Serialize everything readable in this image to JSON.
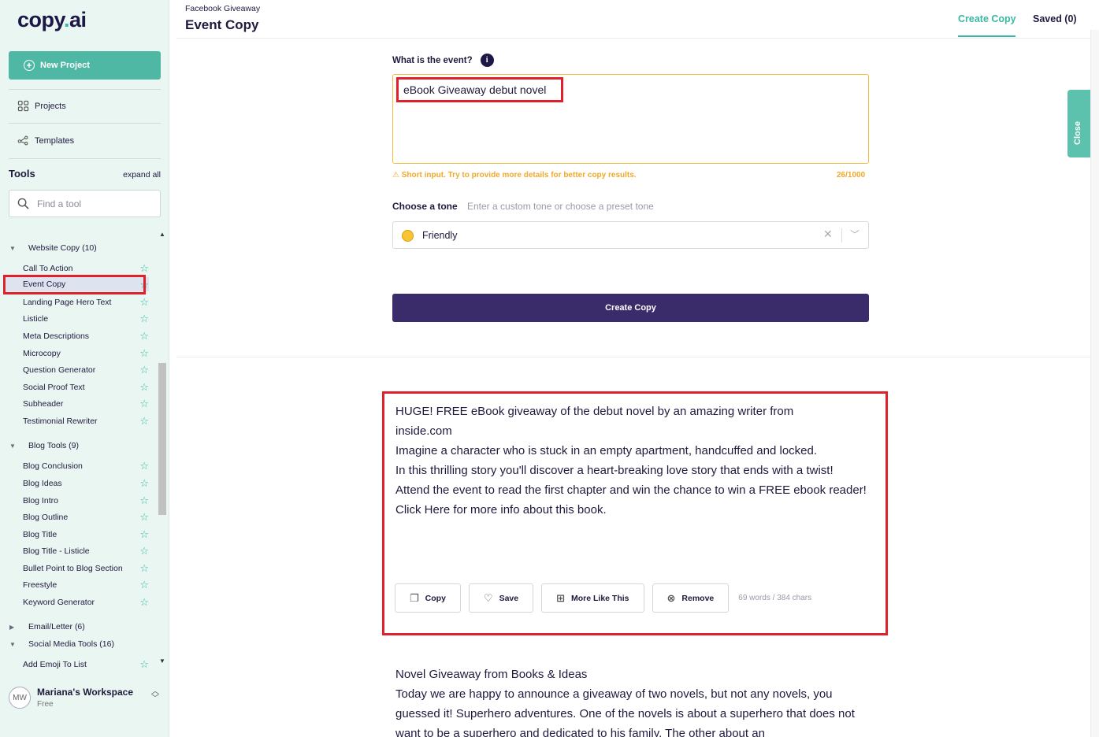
{
  "sidebar": {
    "logo_main": "copy",
    "logo_dot": ".",
    "logo_end": "ai",
    "new_project": "New Project",
    "projects": "Projects",
    "templates": "Templates",
    "tools_title": "Tools",
    "expand_all": "expand all",
    "search_placeholder": "Find a tool",
    "categories": {
      "website": "Website Copy (10)",
      "blog": "Blog Tools (9)",
      "email": "Email/Letter (6)",
      "social": "Social Media Tools (16)"
    },
    "website_tools": [
      "Call To Action",
      "Event Copy",
      "Landing Page Hero Text",
      "Listicle",
      "Meta Descriptions",
      "Microcopy",
      "Question Generator",
      "Social Proof Text",
      "Subheader",
      "Testimonial Rewriter"
    ],
    "blog_tools": [
      "Blog Conclusion",
      "Blog Ideas",
      "Blog Intro",
      "Blog Outline",
      "Blog Title",
      "Blog Title - Listicle",
      "Bullet Point to Blog Section",
      "Freestyle",
      "Keyword Generator"
    ],
    "social_tools": [
      "Add Emoji To List"
    ],
    "workspace": {
      "initials": "MW",
      "name": "Mariana's Workspace",
      "plan": "Free"
    }
  },
  "header": {
    "breadcrumb": "Facebook Giveaway",
    "title": "Event Copy",
    "tab_create": "Create Copy",
    "tab_saved": "Saved (0)"
  },
  "form": {
    "event_label": "What is the event?",
    "event_value": "eBook Giveaway debut novel",
    "warning": "⚠ Short input. Try to provide more details for better copy results.",
    "counter": "26/1000",
    "tone_label": "Choose a tone",
    "tone_hint": "Enter a custom tone or choose a preset tone",
    "tone_value": "Friendly",
    "create_button": "Create Copy"
  },
  "close_tab": "Close",
  "results": [
    {
      "lines": [
        "HUGE! FREE eBook giveaway of the debut novel by an amazing writer from inside.com",
        "Imagine a character who is stuck in an empty apartment, handcuffed and locked.",
        "In this thrilling story you'll discover a heart-breaking love story that ends with a twist!",
        "Attend the event to read the first chapter and win the chance to win a FREE ebook reader!",
        "Click Here for more info about this book."
      ],
      "actions": {
        "copy": "Copy",
        "save": "Save",
        "more": "More Like This",
        "remove": "Remove"
      },
      "stats": "69 words / 384 chars"
    },
    {
      "lines": [
        "Novel Giveaway from Books & Ideas",
        "Today we are happy to announce a giveaway of two novels, but not any novels, you guessed it! Superhero adventures. One of the novels is about a superhero that does not want to be a superhero and dedicated to his family. The other about an"
      ]
    }
  ],
  "colors": {
    "accent": "#39b8a3",
    "primary": "#3a2b6b",
    "warning": "#f0a92a",
    "highlight": "#e0212c",
    "sidebar_bg": "#e9f6f2"
  }
}
